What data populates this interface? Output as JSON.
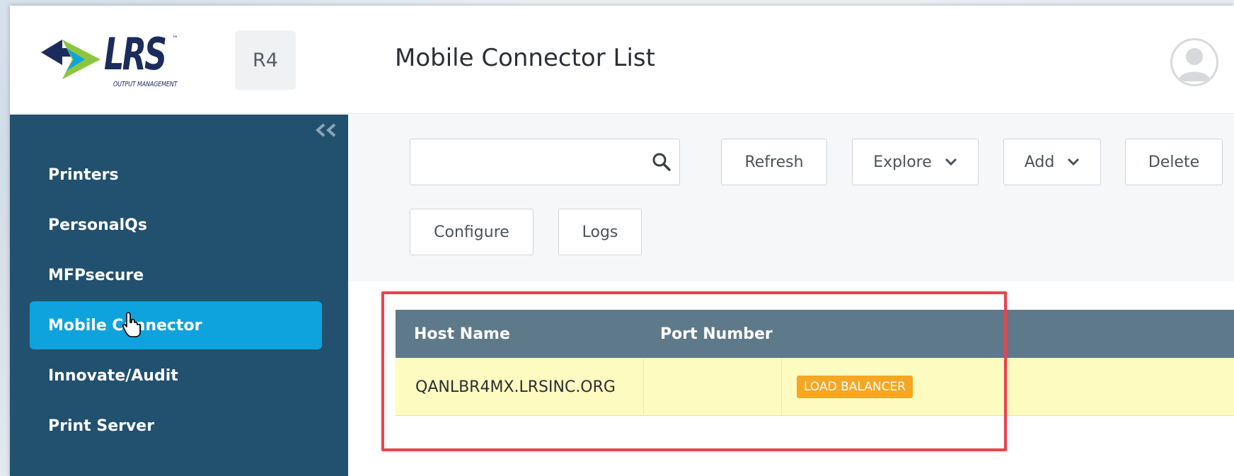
{
  "app": {
    "logo_text": "LRS",
    "logo_tm": "™",
    "logo_subtitle": "OUTPUT MANAGEMENT",
    "version_badge": "R4",
    "page_title": "Mobile Connector List"
  },
  "colors": {
    "sidebar_bg": "#22506f",
    "active_item": "#0ea3dd",
    "table_header": "#5e7a8a",
    "row_highlight": "#fdfbc0",
    "badge": "#f5a623",
    "annotation_box": "#e5444f"
  },
  "sidebar": {
    "collapse_icon": "double-chevron-left-icon",
    "items": [
      {
        "label": "Printers",
        "active": false
      },
      {
        "label": "PersonalQs",
        "active": false
      },
      {
        "label": "MFPsecure",
        "active": false
      },
      {
        "label": "Mobile Connector",
        "active": true
      },
      {
        "label": "Innovate/Audit",
        "active": false
      },
      {
        "label": "Print Server",
        "active": false
      }
    ]
  },
  "toolbar": {
    "search": {
      "value": "",
      "placeholder": "",
      "icon": "search-icon"
    },
    "refresh_label": "Refresh",
    "explore_label": "Explore",
    "add_label": "Add",
    "delete_label": "Delete",
    "configure_label": "Configure",
    "logs_label": "Logs"
  },
  "table": {
    "columns": [
      "Host Name",
      "Port Number"
    ],
    "rows": [
      {
        "host_name": "QANLBR4MX.LRSINC.ORG",
        "port_number": "",
        "tag": "LOAD BALANCER"
      }
    ]
  }
}
